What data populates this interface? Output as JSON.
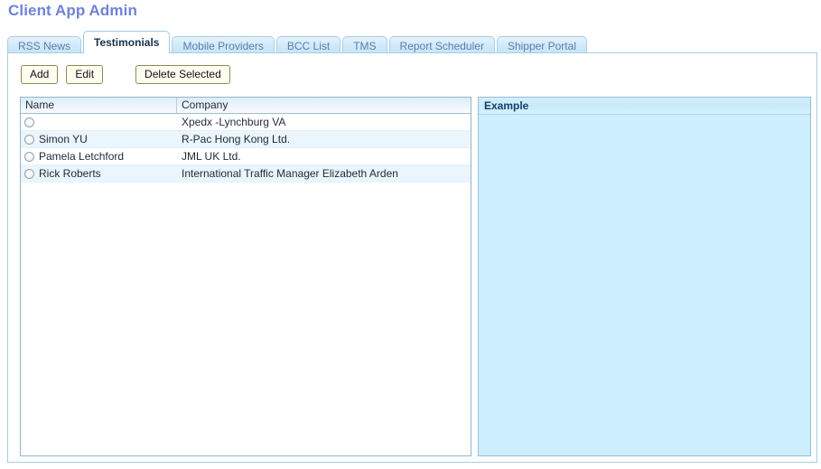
{
  "page": {
    "title": "Client App Admin"
  },
  "tabs": [
    {
      "label": "RSS News",
      "active": false
    },
    {
      "label": "Testimonials",
      "active": true
    },
    {
      "label": "Mobile Providers",
      "active": false
    },
    {
      "label": "BCC List",
      "active": false
    },
    {
      "label": "TMS",
      "active": false
    },
    {
      "label": "Report Scheduler",
      "active": false
    },
    {
      "label": "Shipper Portal",
      "active": false
    }
  ],
  "toolbar": {
    "add_label": "Add",
    "edit_label": "Edit",
    "delete_label": "Delete Selected"
  },
  "grid": {
    "columns": [
      "Name",
      "Company"
    ],
    "rows": [
      {
        "selected": false,
        "name": "",
        "company": "Xpedx -Lynchburg VA"
      },
      {
        "selected": false,
        "name": "Simon YU",
        "company": "R-Pac Hong Kong Ltd."
      },
      {
        "selected": false,
        "name": "Pamela Letchford",
        "company": "JML UK Ltd."
      },
      {
        "selected": false,
        "name": "Rick Roberts",
        "company": "International Traffic Manager Elizabeth Arden"
      }
    ]
  },
  "example_panel": {
    "title": "Example",
    "body_text": ""
  },
  "colors": {
    "title_blue": "#6d83d6",
    "tab_inactive": "#cfe8fa",
    "tab_border": "#a8cfe8",
    "panel_border": "#a9cce2",
    "grid_border": "#91b6cc",
    "row_alt": "#eaf5fd",
    "example_body": "#cdeefc",
    "example_title": "#14406b",
    "button_face": "#fdfdf0",
    "button_border": "#8a8a4a"
  }
}
